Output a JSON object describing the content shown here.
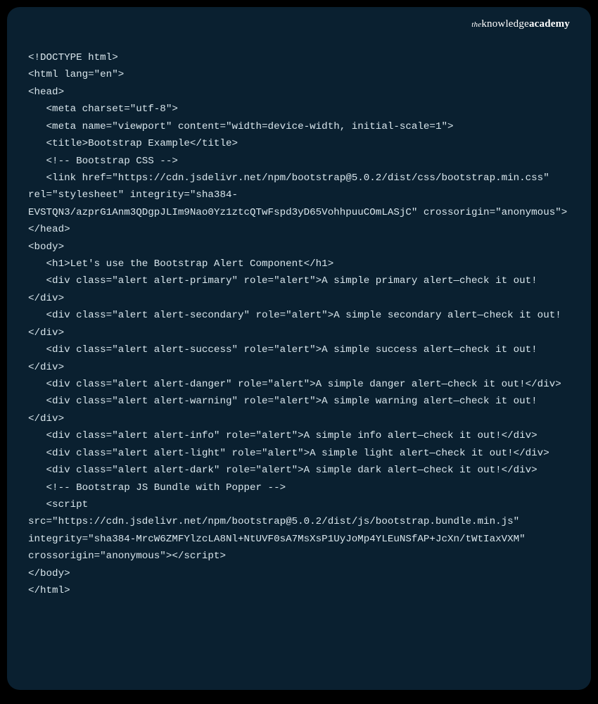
{
  "brand": {
    "the": "the",
    "knowledge": "knowledge",
    "academy": "academy"
  },
  "code": {
    "lines": [
      "<!DOCTYPE html>",
      "<html lang=\"en\">",
      "<head>",
      "   <meta charset=\"utf-8\">",
      "   <meta name=\"viewport\" content=\"width=device-width, initial-scale=1\">",
      "   <title>Bootstrap Example</title>",
      "   <!-- Bootstrap CSS -->",
      "   <link href=\"https://cdn.jsdelivr.net/npm/bootstrap@5.0.2/dist/css/bootstrap.min.css\" rel=\"stylesheet\" integrity=\"sha384-EVSTQN3/azprG1Anm3QDgpJLIm9Nao0Yz1ztcQTwFspd3yD65VohhpuuCOmLASjC\" crossorigin=\"anonymous\">",
      "</head>",
      "<body>",
      "   <h1>Let's use the Bootstrap Alert Component</h1>",
      "   <div class=\"alert alert-primary\" role=\"alert\">A simple primary alert—check it out!</div>",
      "   <div class=\"alert alert-secondary\" role=\"alert\">A simple secondary alert—check it out!</div>",
      "   <div class=\"alert alert-success\" role=\"alert\">A simple success alert—check it out!</div>",
      "   <div class=\"alert alert-danger\" role=\"alert\">A simple danger alert—check it out!</div>",
      "   <div class=\"alert alert-warning\" role=\"alert\">A simple warning alert—check it out!</div>",
      "   <div class=\"alert alert-info\" role=\"alert\">A simple info alert—check it out!</div>",
      "   <div class=\"alert alert-light\" role=\"alert\">A simple light alert—check it out!</div>",
      "   <div class=\"alert alert-dark\" role=\"alert\">A simple dark alert—check it out!</div>",
      "   <!-- Bootstrap JS Bundle with Popper -->",
      "   <script src=\"https://cdn.jsdelivr.net/npm/bootstrap@5.0.2/dist/js/bootstrap.bundle.min.js\" integrity=\"sha384-MrcW6ZMFYlzcLA8Nl+NtUVF0sA7MsXsP1UyJoMp4YLEuNSfAP+JcXn/tWtIaxVXM\" crossorigin=\"anonymous\"></script>",
      "</body>",
      "</html>"
    ]
  }
}
